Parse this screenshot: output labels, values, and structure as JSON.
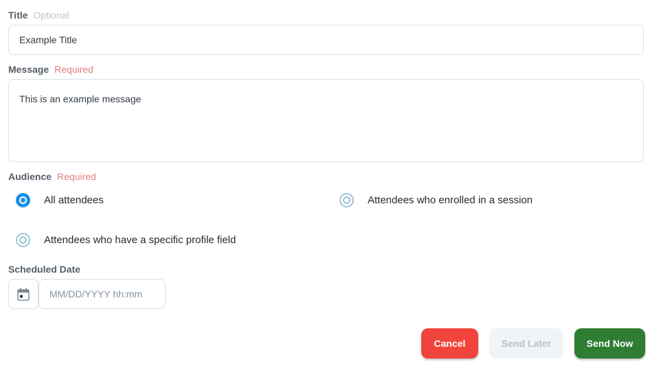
{
  "title_field": {
    "label": "Title",
    "hint": "Optional",
    "value": "Example Title"
  },
  "message_field": {
    "label": "Message",
    "hint": "Required",
    "value": "This is an example message"
  },
  "audience": {
    "label": "Audience",
    "hint": "Required",
    "options": [
      {
        "label": "All attendees",
        "selected": true
      },
      {
        "label": "Attendees who enrolled in a session",
        "selected": false
      },
      {
        "label": "Attendees who have a specific profile field",
        "selected": false
      }
    ]
  },
  "scheduled_date": {
    "label": "Scheduled Date",
    "placeholder": "MM/DD/YYYY hh:mm",
    "icon": "calendar-icon"
  },
  "actions": {
    "cancel_label": "Cancel",
    "send_later_label": "Send Later",
    "send_now_label": "Send Now"
  },
  "colors": {
    "cancel": "#f1443c",
    "send_now": "#2e7d32",
    "radio_selected": "#1a8fe8",
    "required_hint": "#e07f7c"
  }
}
